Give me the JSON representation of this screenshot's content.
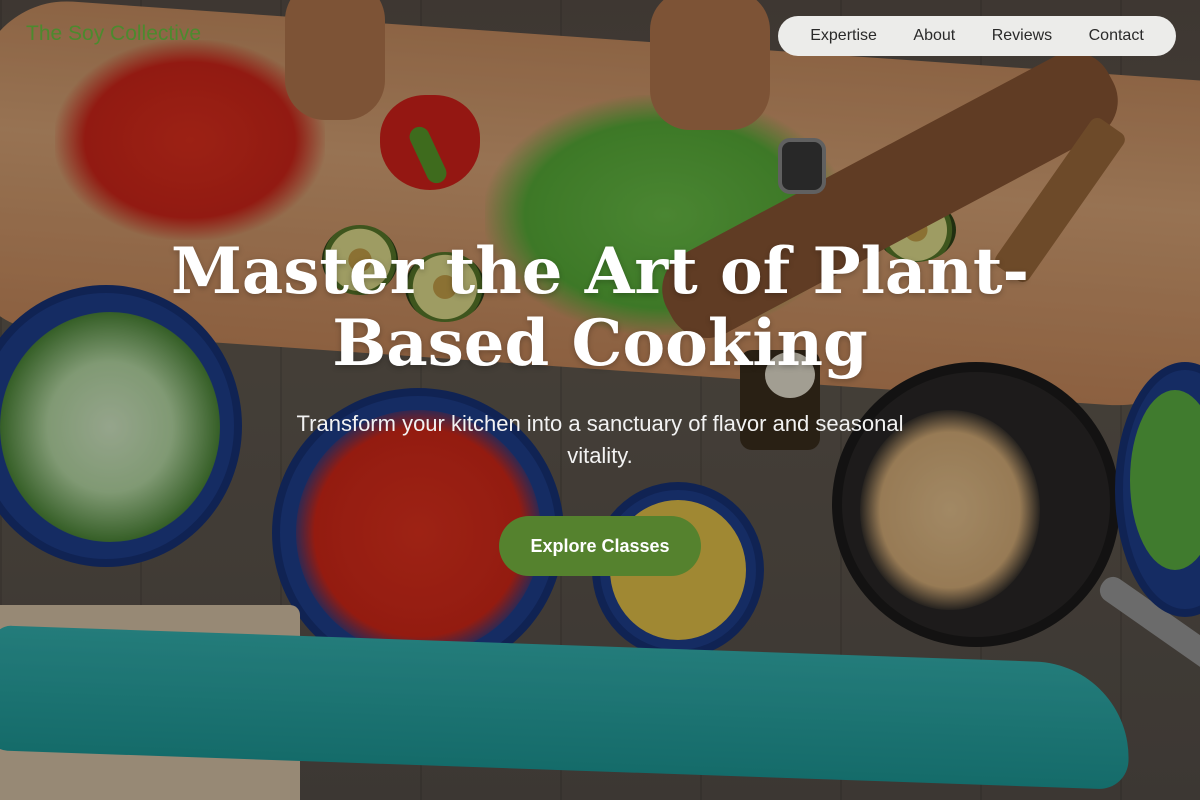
{
  "brand": {
    "name": "The Soy Collective"
  },
  "nav": {
    "items": [
      {
        "label": "Expertise"
      },
      {
        "label": "About"
      },
      {
        "label": "Reviews"
      },
      {
        "label": "Contact"
      }
    ]
  },
  "hero": {
    "title": "Master the Art of Plant-Based Cooking",
    "subtitle": "Transform your kitchen into a sanctuary of flavor and seasonal vitality.",
    "cta_label": "Explore Classes",
    "background_image": "overhead view of hands preparing vegetables on a wooden table"
  },
  "colors": {
    "brand_green": "#4c8a2e",
    "cta_green": "#55822e",
    "nav_bg": "#ececea",
    "title_white": "#ffffff"
  }
}
